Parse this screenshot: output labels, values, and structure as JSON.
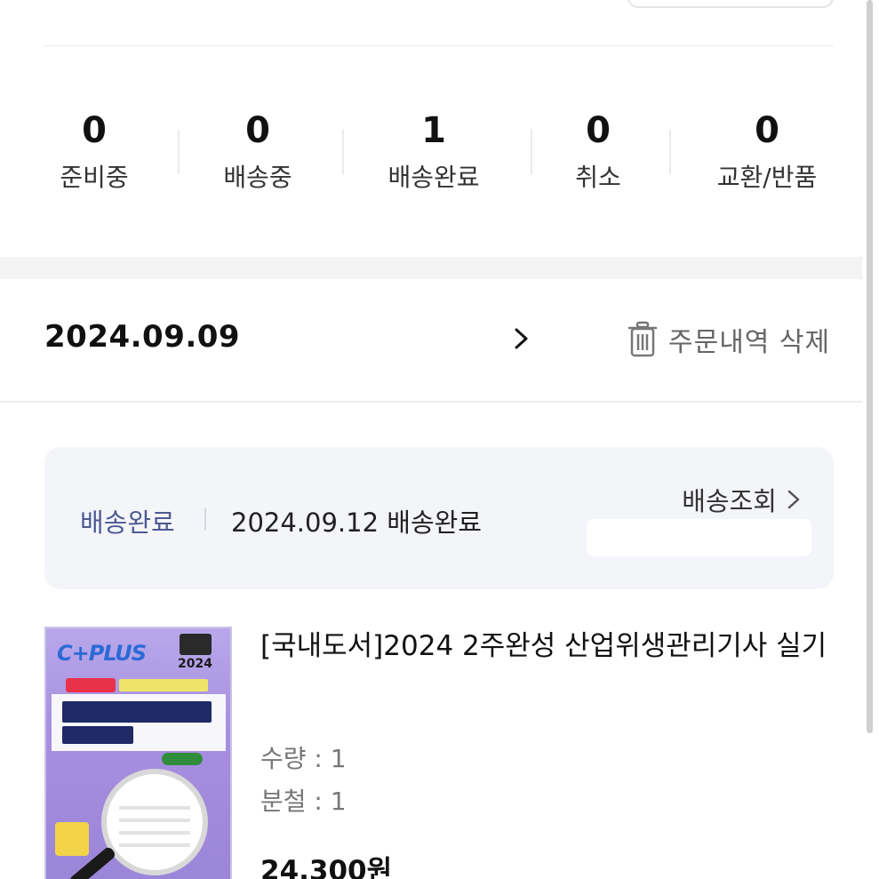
{
  "order_status_summary": [
    {
      "count": "0",
      "label": "준비중"
    },
    {
      "count": "0",
      "label": "배송중"
    },
    {
      "count": "1",
      "label": "배송완료"
    },
    {
      "count": "0",
      "label": "취소"
    },
    {
      "count": "0",
      "label": "교환/반품"
    }
  ],
  "order": {
    "date": "2024.09.09",
    "delete_label": "주문내역 삭제"
  },
  "delivery": {
    "status": "배송완료",
    "detail": "2024.09.12 배송완료",
    "track_label": "배송조회"
  },
  "product": {
    "title": "[국내도서]2024 2주완성 산업위생관리기사 실기",
    "quantity": "수량 : 1",
    "split": "분철 : 1",
    "price": "24,300원"
  },
  "colors": {
    "accent": "#4e5a93",
    "card_bg": "#f4f5f9",
    "book_cover": "#a78ee0"
  }
}
